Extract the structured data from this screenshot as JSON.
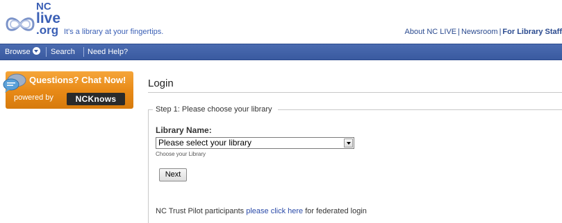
{
  "header": {
    "logo": {
      "nc": "NC",
      "live": "live",
      "org": ".org"
    },
    "tagline": "It's a library at your fingertips.",
    "links": [
      {
        "label": "About NC LIVE"
      },
      {
        "label": "Newsroom"
      },
      {
        "label": "For Library Staff"
      }
    ],
    "link_sep": "|"
  },
  "navbar": {
    "browse": "Browse",
    "search": "Search",
    "help": "Need Help?"
  },
  "chat": {
    "title": "Questions? Chat Now!",
    "powered_by": "powered by",
    "brand": "NCKnows"
  },
  "main": {
    "title": "Login",
    "step_legend": "Step 1: Please choose your library",
    "library_label": "Library Name:",
    "select_value": "Please select your library",
    "help_text": "Choose your Library",
    "next_label": "Next",
    "federated": {
      "before": "NC Trust Pilot participants ",
      "link": "please click here",
      "after": " for federated login"
    }
  },
  "colors": {
    "brand_blue": "#3a5fb5",
    "nav_blue": "#3a5aa0",
    "chat_orange": "#e88a17"
  }
}
